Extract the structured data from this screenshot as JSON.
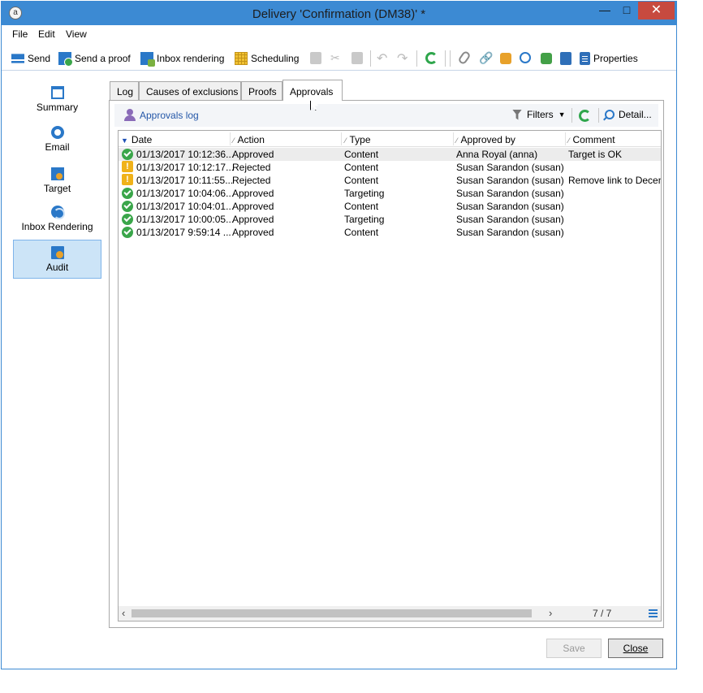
{
  "window": {
    "title": "Delivery 'Confirmation (DM38)' *",
    "app_icon": "adobe-campaign-icon"
  },
  "menu": {
    "file": "File",
    "edit": "Edit",
    "view": "View"
  },
  "toolbar": {
    "send": "Send",
    "send_proof": "Send a proof",
    "inbox_rendering": "Inbox rendering",
    "scheduling": "Scheduling",
    "properties": "Properties"
  },
  "nav": {
    "summary": "Summary",
    "email": "Email",
    "target": "Target",
    "inbox_rendering": "Inbox Rendering",
    "audit": "Audit"
  },
  "tabs": {
    "log": "Log",
    "causes": "Causes of exclusions",
    "proofs": "Proofs",
    "approvals": "Approvals"
  },
  "subbar": {
    "approvals_log": "Approvals log",
    "filters": "Filters",
    "detail": "Detail..."
  },
  "grid": {
    "columns": {
      "date": "Date",
      "action": "Action",
      "type": "Type",
      "approved_by": "Approved by",
      "comment": "Comment"
    },
    "rows": [
      {
        "status": "ok",
        "date": "01/13/2017 10:12:36...",
        "action": "Approved",
        "type": "Content",
        "approved_by": "Anna Royal (anna)",
        "comment": "Target is OK"
      },
      {
        "status": "warn",
        "date": "01/13/2017 10:12:17...",
        "action": "Rejected",
        "type": "Content",
        "approved_by": "Susan Sarandon (susan)",
        "comment": ""
      },
      {
        "status": "warn",
        "date": "01/13/2017 10:11:55...",
        "action": "Rejected",
        "type": "Content",
        "approved_by": "Susan Sarandon (susan)",
        "comment": "Remove link to Decen"
      },
      {
        "status": "ok",
        "date": "01/13/2017 10:04:06...",
        "action": "Approved",
        "type": "Targeting",
        "approved_by": "Susan Sarandon (susan)",
        "comment": ""
      },
      {
        "status": "ok",
        "date": "01/13/2017 10:04:01...",
        "action": "Approved",
        "type": "Content",
        "approved_by": "Susan Sarandon (susan)",
        "comment": ""
      },
      {
        "status": "ok",
        "date": "01/13/2017 10:00:05...",
        "action": "Approved",
        "type": "Targeting",
        "approved_by": "Susan Sarandon (susan)",
        "comment": ""
      },
      {
        "status": "ok",
        "date": "01/13/2017 9:59:14 ...",
        "action": "Approved",
        "type": "Content",
        "approved_by": "Susan Sarandon (susan)",
        "comment": ""
      }
    ],
    "count": "7 / 7"
  },
  "footer": {
    "save": "Save",
    "close": "Close"
  },
  "colors": {
    "titlebar": "#3c8ad3",
    "accent": "#2a78c8",
    "ok": "#3aa64a",
    "warn": "#f0b21a",
    "close_btn": "#c74a3f"
  }
}
